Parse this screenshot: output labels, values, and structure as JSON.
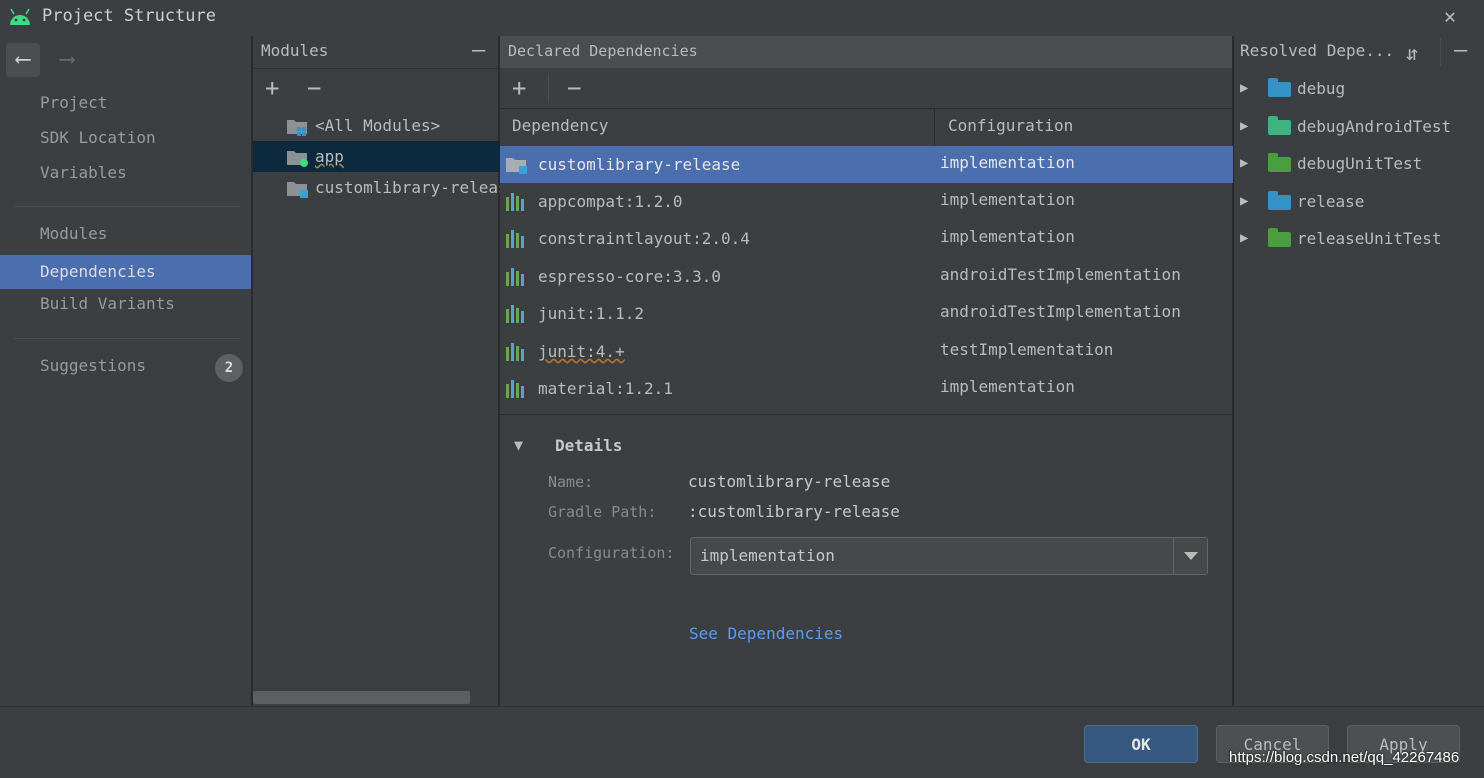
{
  "window": {
    "title": "Project Structure",
    "close": "✕"
  },
  "nav": {
    "back": "⟵",
    "forward": "⟶",
    "items": [
      {
        "label": "Project"
      },
      {
        "label": "SDK Location"
      },
      {
        "label": "Variables"
      },
      {
        "label": "Modules"
      },
      {
        "label": "Dependencies"
      },
      {
        "label": "Build Variants"
      },
      {
        "label": "Suggestions",
        "badge": "2"
      }
    ]
  },
  "modules": {
    "title": "Modules",
    "add": "+",
    "remove": "−",
    "collapse": "—",
    "items": [
      {
        "label": "<All Modules>"
      },
      {
        "label": "app"
      },
      {
        "label": "customlibrary-release"
      }
    ]
  },
  "declared": {
    "title": "Declared Dependencies",
    "add": "+",
    "remove": "−",
    "columns": {
      "dependency": "Dependency",
      "configuration": "Configuration"
    },
    "rows": [
      {
        "name": "customlibrary-release",
        "configuration": "implementation"
      },
      {
        "name": "appcompat:1.2.0",
        "configuration": "implementation"
      },
      {
        "name": "constraintlayout:2.0.4",
        "configuration": "implementation"
      },
      {
        "name": "espresso-core:3.3.0",
        "configuration": "androidTestImplementation"
      },
      {
        "name": "junit:1.1.2",
        "configuration": "androidTestImplementation"
      },
      {
        "name": "junit:4.+",
        "configuration": "testImplementation"
      },
      {
        "name": "material:1.2.1",
        "configuration": "implementation"
      }
    ]
  },
  "details": {
    "title": "Details",
    "toggle": "▼",
    "name_label": "Name:",
    "name_value": "customlibrary-release",
    "gradle_label": "Gradle Path:",
    "gradle_value": ":customlibrary-release",
    "config_label": "Configuration:",
    "config_value": "implementation",
    "see_deps": "See Dependencies"
  },
  "resolved": {
    "title": "Resolved Depe...",
    "expand": "⇵",
    "collapse": "—",
    "items": [
      {
        "label": "debug",
        "color": "#3592c4"
      },
      {
        "label": "debugAndroidTest",
        "color": "#3fb37f"
      },
      {
        "label": "debugUnitTest",
        "color": "#4a9e3f"
      },
      {
        "label": "release",
        "color": "#3592c4"
      },
      {
        "label": "releaseUnitTest",
        "color": "#4a9e3f"
      }
    ]
  },
  "footer": {
    "ok": "OK",
    "cancel": "Cancel",
    "apply": "Apply",
    "watermark": "https://blog.csdn.net/qq_42267486"
  },
  "colors": {
    "accent": "#4b6eaf",
    "ok": "#365880",
    "link": "#589df6"
  }
}
